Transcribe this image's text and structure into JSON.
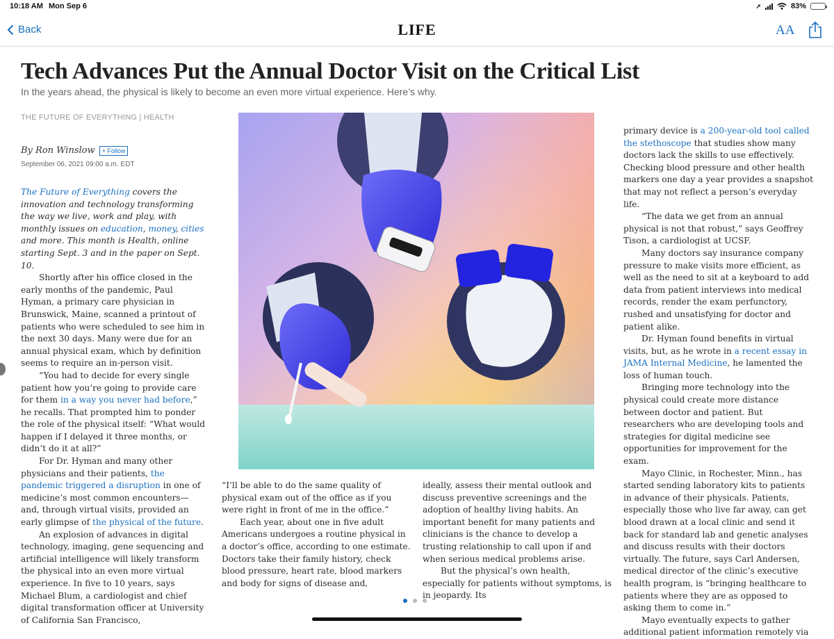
{
  "status": {
    "time": "10:18 AM",
    "date": "Mon Sep 6",
    "battery": "83%",
    "battery_level": 0.83
  },
  "nav": {
    "back_label": "Back",
    "logo": "LIFE",
    "font_button": "AA"
  },
  "article": {
    "headline": "Tech Advances Put the Annual Doctor Visit on the Critical List",
    "dek": "In the years ahead, the physical is likely to become an even more virtual experience. Here’s why.",
    "section": "THE FUTURE OF EVERYTHING | HEALTH",
    "author": "By Ron Winslow",
    "follow": "+ Follow",
    "date": "September 06, 2021 09:00 a.m. EDT"
  },
  "col1": {
    "intro_link": "The Future of Everything",
    "intro_text1": " covers the innovation and technology transforming the way we live, work and play, with monthly issues on ",
    "link_education": "education",
    "comma1": ", ",
    "link_money": "money",
    "comma2": ", ",
    "link_cities": "cities",
    "intro_text2": " and more. This month is Health, online starting Sept. 3 and in the paper on Sept. 10.",
    "p1": "Shortly after his office closed in the early months of the pandemic, Paul Hyman, a primary care physician in Brunswick, Maine, scanned a printout of patients who were scheduled to see him in the next 30 days. Many were due for an annual physical exam, which by definition seems to require an in-person visit.",
    "p2a": "“You had to decide for every single patient how you’re going to provide care for them ",
    "p2_link": "in a way you never had before",
    "p2b": ",” he recalls. That prompted him to ponder the role of the physical itself: “What would happen if I delayed it three months, or didn’t do it at all?”",
    "p3a": "For Dr. Hyman and many other physicians and their patients, ",
    "p3_link1": "the pandemic triggered a disruption",
    "p3b": " in one of medicine’s most common encounters—and, through virtual visits, provided an early glimpse of ",
    "p3_link2": "the physical of the future",
    "p3c": ".",
    "p4": "An explosion of advances in digital technology, imaging, gene sequencing and artificial intelligence will likely transform the physical into an even more virtual experience. In five to 10 years, says Michael Blum, a cardiologist and chief digital transformation officer at University of California San Francisco,"
  },
  "col2": {
    "p1": "“I’ll be able to do the same quality of physical exam out of the office as if you were right in front of me in the office.”",
    "p2": "Each year, about one in five adult Americans undergoes a routine physical in a doctor’s office, according to one estimate. Doctors take their family history, check blood pressure, heart rate, blood markers and body for signs of disease and,"
  },
  "col3": {
    "p1": "ideally, assess their mental outlook and discuss preventive screenings and the adoption of healthy living habits. An important benefit for many patients and clinicians is the chance to develop a trusting relationship to call upon if and when serious medical problems arise.",
    "p2": "But the physical’s own health, especially for patients without symptoms, is in jeopardy. Its"
  },
  "col4": {
    "p1a": "primary device is ",
    "p1_link": "a 200-year-old tool called the stethoscope",
    "p1b": " that studies show many doctors lack the skills to use effectively. Checking blood pressure and other health markers one day a year provides a snapshot that may not reflect a person’s everyday life.",
    "p2": "“The data we get from an annual physical is not that robust,” says Geoffrey Tison, a cardiologist at UCSF.",
    "p3": "Many doctors say insurance company pressure to make visits more efficient, as well as the need to sit at a keyboard to add data from patient interviews into medical records, render the exam perfunctory, rushed and unsatisfying for doctor and patient alike.",
    "p4a": "Dr. Hyman found benefits in virtual visits, but, as he wrote in ",
    "p4_link": "a recent essay in JAMA Internal Medicine",
    "p4b": ", he lamented the loss of human touch.",
    "p5": "Bringing more technology into the physical could create more distance between doctor and patient. But researchers who are developing tools and strategies for digital medicine see opportunities for improvement for the exam.",
    "p6": "Mayo Clinic, in Rochester, Minn., has started sending laboratory kits to patients in advance of their physicals. Patients, especially those who live far away, can get blood drawn at a local clinic and send it back for standard lab and genetic analyses and discuss results with their doctors virtually. The future, says Carl Andersen, medical director of the clinic’s executive health program, is “bringing healthcare to patients where they are as opposed to asking them to come in.”",
    "p7": "Mayo eventually expects to gather additional patient information remotely via"
  },
  "colors": {
    "link": "#1a6fc0",
    "page_dot_active": "#1a6fc0",
    "page_dot_inactive": "#bbbbbb"
  },
  "pagination": {
    "pages": 3,
    "current": 1
  }
}
